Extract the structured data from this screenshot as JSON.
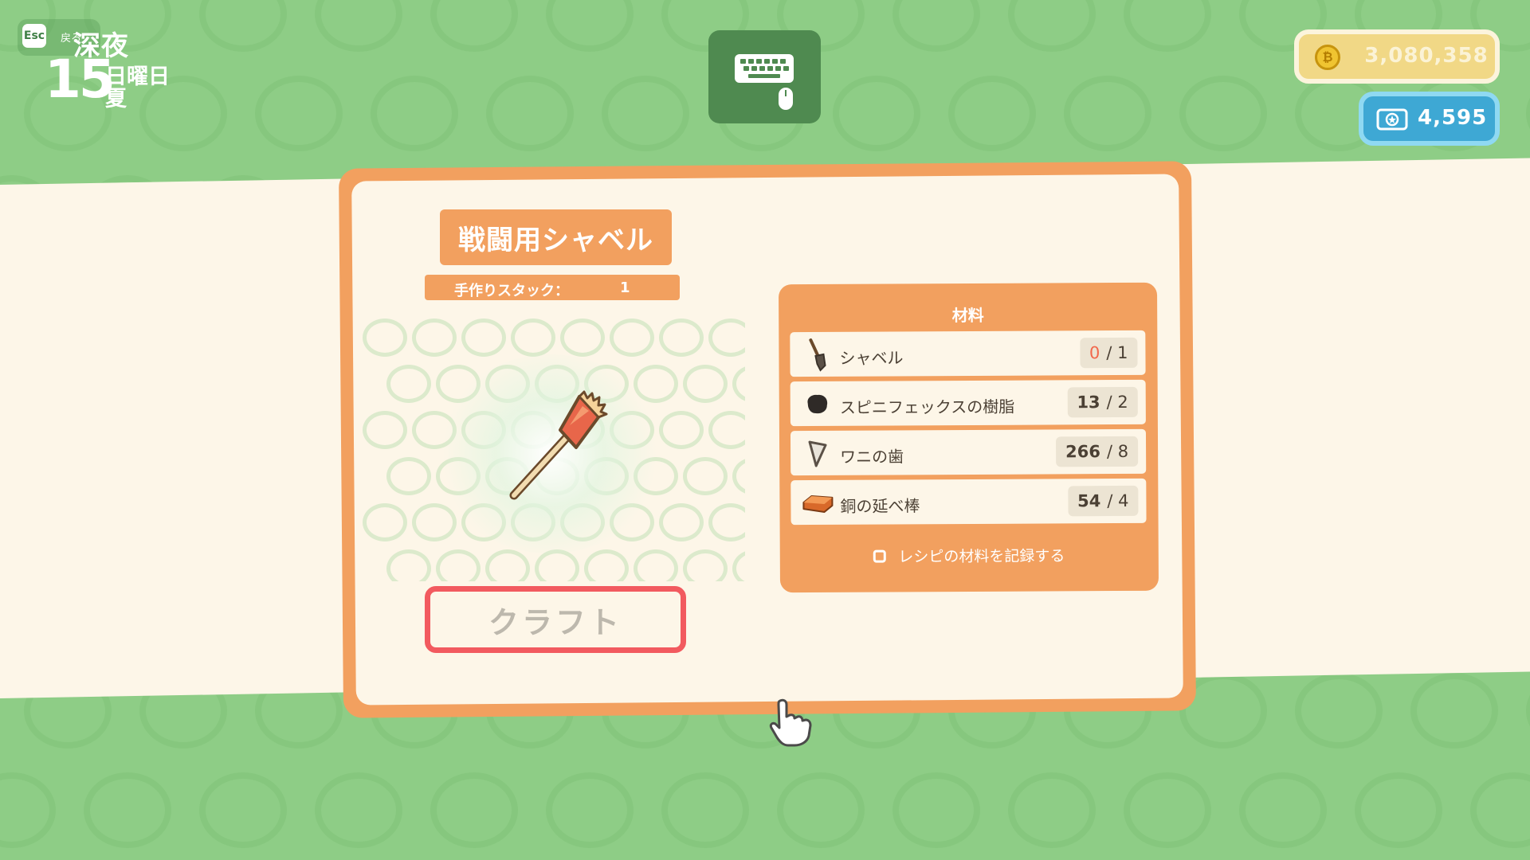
{
  "hud": {
    "esc_key": "Esc",
    "back_label": "戻る",
    "time_of_day": "深夜",
    "day_number": "15",
    "weekday": "日曜日",
    "season": "夏",
    "control_scheme_icon": "keyboard-mouse-icon"
  },
  "currency": {
    "coins": "3,080,358",
    "coin_icon": "coin-icon",
    "tickets": "4,595",
    "ticket_icon": "ticket-icon"
  },
  "recipe": {
    "item_name": "戦闘用シャベル",
    "stack_label": "手作りスタック：",
    "stack_value": "1",
    "item_icon": "battle-shovel-icon",
    "craft_button": "クラフト"
  },
  "materials": {
    "title": "材料",
    "items": [
      {
        "name": "シャベル",
        "owned": "0",
        "required": "/ 1",
        "icon": "shovel-icon",
        "insufficient": true
      },
      {
        "name": "スピニフェックスの樹脂",
        "owned": "13",
        "required": "/ 2",
        "icon": "resin-icon",
        "insufficient": false
      },
      {
        "name": "ワニの歯",
        "owned": "266",
        "required": "/ 8",
        "icon": "crocodile-tooth-icon",
        "insufficient": false
      },
      {
        "name": "銅の延べ棒",
        "owned": "54",
        "required": "/ 4",
        "icon": "copper-bar-icon",
        "insufficient": false
      }
    ],
    "record_option": "レシピの材料を記録する"
  },
  "colors": {
    "background": "#8ecd86",
    "panel_orange": "#f2a05f",
    "panel_cream": "#fdf6e8",
    "craft_border": "#f25a5f",
    "coin_gold": "#f1d886",
    "ticket_blue": "#3ea8d4"
  }
}
